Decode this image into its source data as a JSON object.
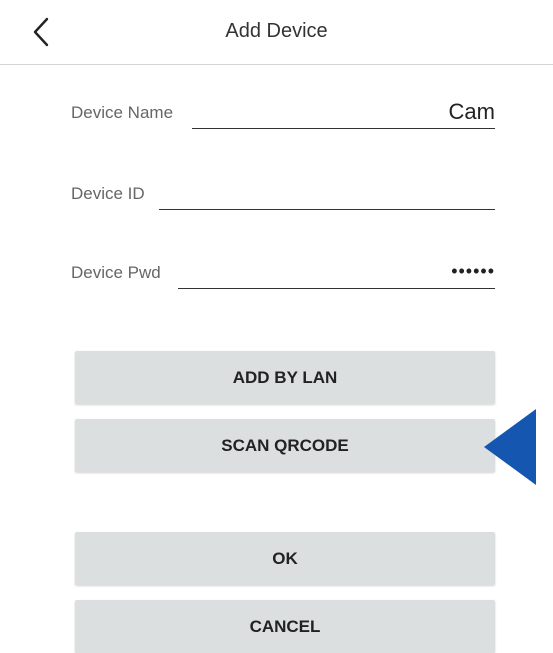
{
  "header": {
    "title": "Add Device",
    "back_icon": "chevron-left-icon"
  },
  "form": {
    "device_name": {
      "label": "Device Name",
      "value": "Cam"
    },
    "device_id": {
      "label": "Device ID",
      "value": ""
    },
    "device_pwd": {
      "label": "Device Pwd",
      "value": "••••••"
    }
  },
  "buttons": {
    "add_by_lan": "ADD BY LAN",
    "scan_qrcode": "SCAN QRCODE",
    "ok": "OK",
    "cancel": "CANCEL"
  },
  "colors": {
    "button_bg": "#dcdfe0",
    "pointer_arrow": "#1557b0",
    "underline": "#333333"
  },
  "overlay": {
    "pointer_icon": "triangle-left-pointer-icon"
  }
}
